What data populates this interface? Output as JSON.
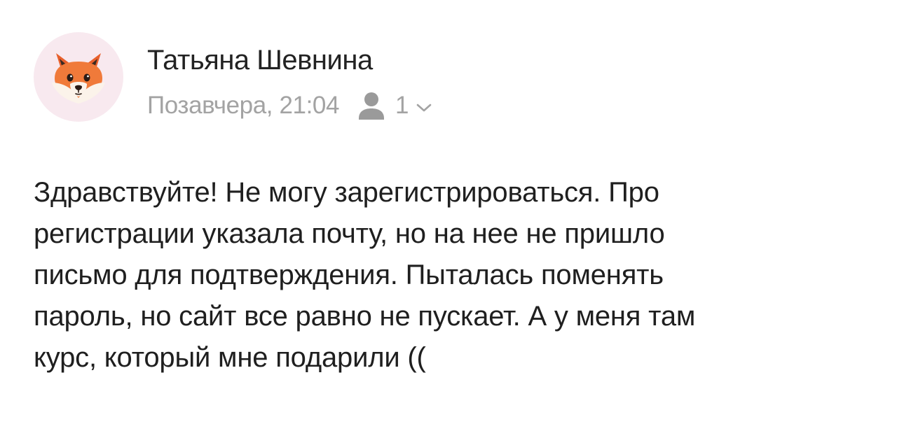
{
  "message": {
    "sender": {
      "name": "Татьяна Шевнина",
      "avatar_icon": "fox-face-icon",
      "avatar_background": "#f8e9ef"
    },
    "meta": {
      "timestamp": "Позавчера, 21:04",
      "recipient_icon": "person-icon",
      "recipient_count": "1",
      "expand_icon": "chevron-down-icon"
    },
    "body": {
      "lines": [
        "Здравствуйте! Не могу зарегистрироваться. Про",
        "регистрации указала почту, но на нее не пришло",
        "письмо для подтверждения. Пыталась поменять",
        "пароль, но сайт все равно не пускает. А у меня там",
        "курс, который мне подарили (("
      ]
    }
  },
  "colors": {
    "text_primary": "#1f1f1f",
    "text_secondary": "#a3a3a3",
    "icon_gray": "#9a9a9a"
  }
}
